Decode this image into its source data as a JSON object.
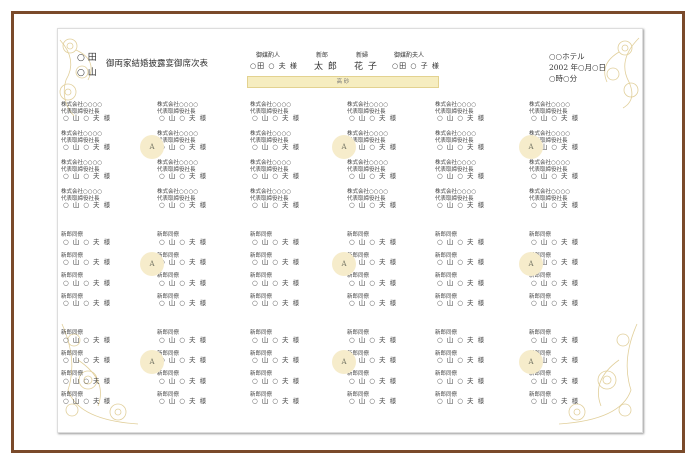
{
  "header": {
    "family_names": [
      "○ 田",
      "○ 山"
    ],
    "title": "御両家結婚披露宴御席次表",
    "groom_matchmaker": {
      "label": "御媒酌人",
      "name": "○田 ○ 夫 様"
    },
    "groom": {
      "label": "新郎",
      "name": "太 郎"
    },
    "bride": {
      "label": "新婦",
      "name": "花 子"
    },
    "matchmaker_wife": {
      "label": "御媒酌夫人",
      "name": "○田 ○ 子 様"
    },
    "venue": "○○ホテル",
    "date": "2002 年○月○日",
    "time": "○時○分"
  },
  "head_table": "高 砂",
  "table_label": "A",
  "guest_company": [
    "株式会社○○○○",
    "代表取締役社長"
  ],
  "guest_colleague": "新郎同僚",
  "guest_name": "○ 山 ○ 夫 様"
}
